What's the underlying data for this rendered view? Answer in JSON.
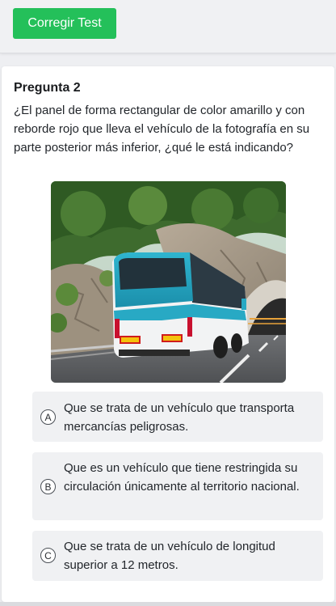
{
  "toolbar": {
    "corregir_label": "Corregir Test"
  },
  "question": {
    "title": "Pregunta 2",
    "text": "¿El panel de forma rectangular de color amarillo y con reborde rojo que lleva el vehículo de la fotografía en su parte posterior más inferior, ¿qué le está indicando?",
    "image_icon": "bus-photo"
  },
  "options": [
    {
      "letter": "A",
      "text": "Que se trata de un vehículo que transporta mercancías peligrosas."
    },
    {
      "letter": "B",
      "text": "Que es un vehículo que tiene restringida su circulación únicamente al territorio nacional."
    },
    {
      "letter": "C",
      "text": "Que se trata de un vehículo de longitud superior a 12 metros."
    }
  ],
  "colors": {
    "accent": "#24c05a",
    "background": "#eeeff2",
    "option_bg": "#f0f1f3"
  }
}
